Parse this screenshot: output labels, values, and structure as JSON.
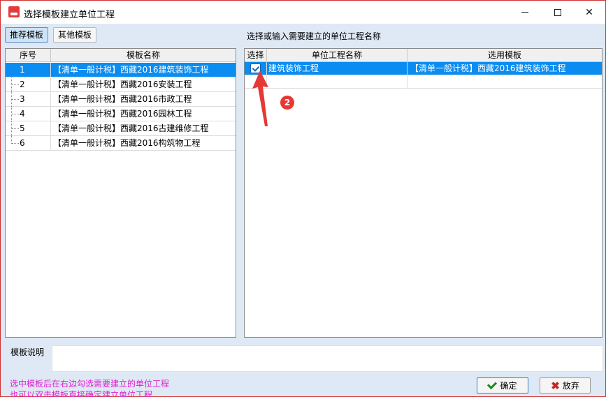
{
  "window": {
    "title": "选择模板建立单位工程"
  },
  "tabs": [
    {
      "label": "推荐模板",
      "active": true
    },
    {
      "label": "其他模板",
      "active": false
    }
  ],
  "prompt": "选择或输入需要建立的单位工程名称",
  "template_grid": {
    "columns": [
      "序号",
      "模板名称"
    ],
    "rows": [
      {
        "index": "1",
        "name": "【清单一般计税】西藏2016建筑装饰工程",
        "selected": true
      },
      {
        "index": "2",
        "name": "【清单一般计税】西藏2016安装工程",
        "selected": false
      },
      {
        "index": "3",
        "name": "【清单一般计税】西藏2016市政工程",
        "selected": false
      },
      {
        "index": "4",
        "name": "【清单一般计税】西藏2016园林工程",
        "selected": false
      },
      {
        "index": "5",
        "name": "【清单一般计税】西藏2016古建维修工程",
        "selected": false
      },
      {
        "index": "6",
        "name": "【清单一般计税】西藏2016构筑物工程",
        "selected": false
      }
    ]
  },
  "project_grid": {
    "columns": [
      "选择",
      "单位工程名称",
      "选用模板"
    ],
    "rows": [
      {
        "checked": true,
        "name": "建筑装饰工程",
        "template": "【清单一般计税】西藏2016建筑装饰工程"
      }
    ]
  },
  "annotation": {
    "badge": "2",
    "color": "#e53935"
  },
  "description_label": "模板说明",
  "hints": [
    "选中模板后在右边勾选需要建立的单位工程",
    "也可以双击模板直接确定建立单位工程"
  ],
  "buttons": {
    "ok": "确定",
    "cancel": "放弃"
  },
  "colors": {
    "selection": "#0a8cf0",
    "hint": "#e020d0",
    "border_accent": "#d03030"
  }
}
